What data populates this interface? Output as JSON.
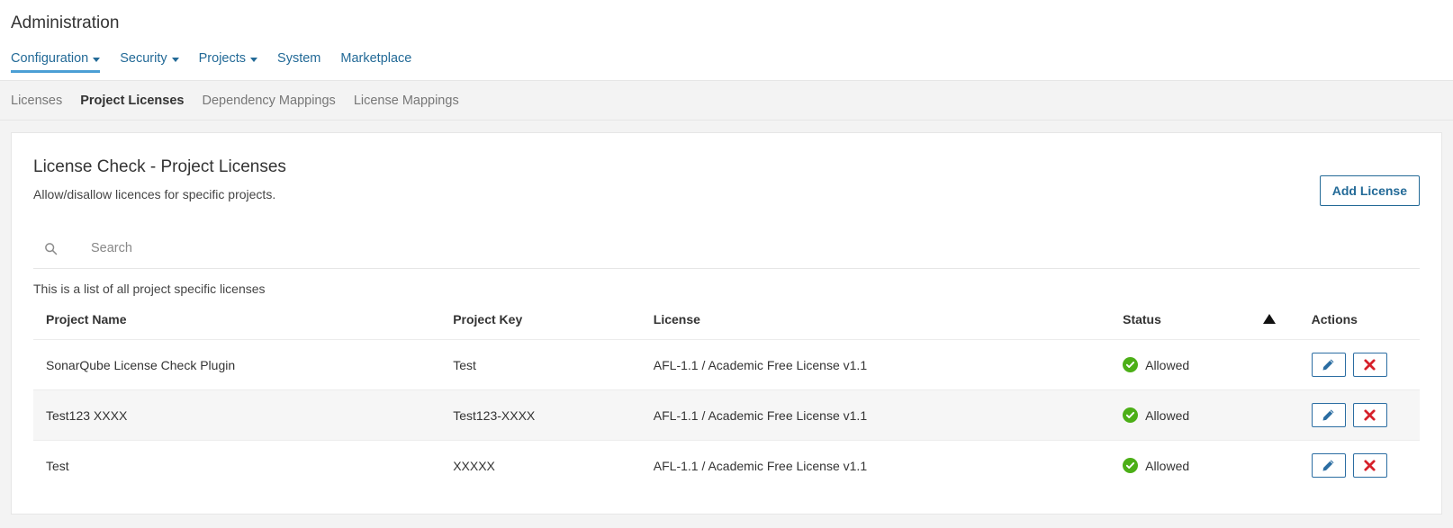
{
  "header": {
    "title": "Administration",
    "nav": [
      {
        "label": "Configuration",
        "has_caret": true,
        "active": true
      },
      {
        "label": "Security",
        "has_caret": true,
        "active": false
      },
      {
        "label": "Projects",
        "has_caret": true,
        "active": false
      },
      {
        "label": "System",
        "has_caret": false,
        "active": false
      },
      {
        "label": "Marketplace",
        "has_caret": false,
        "active": false
      }
    ]
  },
  "sub_nav": [
    {
      "label": "Licenses",
      "active": false
    },
    {
      "label": "Project Licenses",
      "active": true
    },
    {
      "label": "Dependency Mappings",
      "active": false
    },
    {
      "label": "License Mappings",
      "active": false
    }
  ],
  "card": {
    "title": "License Check - Project Licenses",
    "subtitle": "Allow/disallow licences for specific projects.",
    "add_button_label": "Add License"
  },
  "search": {
    "placeholder": "Search",
    "value": "",
    "icon": "search-icon"
  },
  "table": {
    "caption": "This is a list of all project specific licenses",
    "columns": {
      "project_name": "Project Name",
      "project_key": "Project Key",
      "license": "License",
      "status": "Status",
      "actions": "Actions"
    },
    "sort": {
      "column": "Status",
      "direction": "asc",
      "indicator": "triangle-up-icon"
    },
    "rows": [
      {
        "project_name": "SonarQube License Check Plugin",
        "project_key": "Test",
        "license": "AFL-1.1 / Academic Free License v1.1",
        "status": "Allowed",
        "status_icon": "check-circle-icon",
        "edit_icon": "pencil-icon",
        "delete_icon": "close-x-icon"
      },
      {
        "project_name": "Test123 XXXX",
        "project_key": "Test123-XXXX",
        "license": "AFL-1.1 / Academic Free License v1.1",
        "status": "Allowed",
        "status_icon": "check-circle-icon",
        "edit_icon": "pencil-icon",
        "delete_icon": "close-x-icon"
      },
      {
        "project_name": "Test",
        "project_key": "XXXXX",
        "license": "AFL-1.1 / Academic Free License v1.1",
        "status": "Allowed",
        "status_icon": "check-circle-icon",
        "edit_icon": "pencil-icon",
        "delete_icon": "close-x-icon"
      }
    ]
  },
  "colors": {
    "link_blue": "#236a97",
    "accent_underline": "#4b9fd5",
    "status_green": "#4caf17",
    "delete_red": "#d6202a",
    "button_border_blue": "#2b6da2"
  }
}
